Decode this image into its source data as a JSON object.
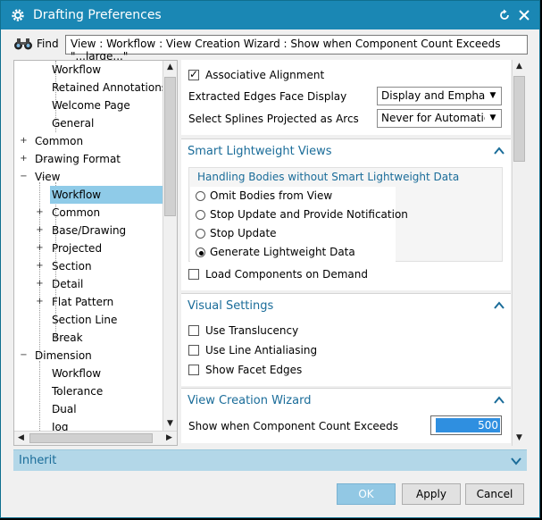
{
  "window": {
    "title": "Drafting Preferences"
  },
  "find": {
    "label": "Find",
    "value": "View : Workflow : View Creation Wizard : Show when Component Count Exceeds \"...large...\""
  },
  "tree": {
    "items": [
      {
        "label": "Workflow"
      },
      {
        "label": "Retained Annotations"
      },
      {
        "label": "Welcome Page"
      },
      {
        "label": "General"
      },
      {
        "label": "Common"
      },
      {
        "label": "Drawing Format"
      },
      {
        "label": "View"
      },
      {
        "label": "Workflow"
      },
      {
        "label": "Common"
      },
      {
        "label": "Base/Drawing"
      },
      {
        "label": "Projected"
      },
      {
        "label": "Section"
      },
      {
        "label": "Detail"
      },
      {
        "label": "Flat Pattern"
      },
      {
        "label": "Section Line"
      },
      {
        "label": "Break"
      },
      {
        "label": "Dimension"
      },
      {
        "label": "Workflow"
      },
      {
        "label": "Tolerance"
      },
      {
        "label": "Dual"
      },
      {
        "label": "Jog"
      }
    ]
  },
  "top_settings": {
    "associative_alignment": "Associative Alignment",
    "extracted_edges_label": "Extracted Edges Face Display",
    "extracted_edges_value": "Display and Emphasize",
    "splines_label": "Select Splines Projected as Arcs",
    "splines_value": "Never for Automatic"
  },
  "smart_lightweight": {
    "title": "Smart Lightweight Views",
    "group_title": "Handling Bodies without Smart Lightweight Data",
    "options": [
      "Omit Bodies from View",
      "Stop Update and Provide Notification",
      "Stop Update",
      "Generate Lightweight Data"
    ],
    "selected": "Generate Lightweight Data",
    "load_on_demand": "Load Components on Demand"
  },
  "visual_settings": {
    "title": "Visual Settings",
    "translucency": "Use Translucency",
    "antialiasing": "Use Line Antialiasing",
    "facet_edges": "Show Facet Edges"
  },
  "view_creation_wizard": {
    "title": "View Creation Wizard",
    "count_label": "Show when Component Count Exceeds",
    "count_value": "500"
  },
  "inherit": {
    "title": "Inherit"
  },
  "buttons": {
    "ok": "OK",
    "apply": "Apply",
    "cancel": "Cancel"
  }
}
